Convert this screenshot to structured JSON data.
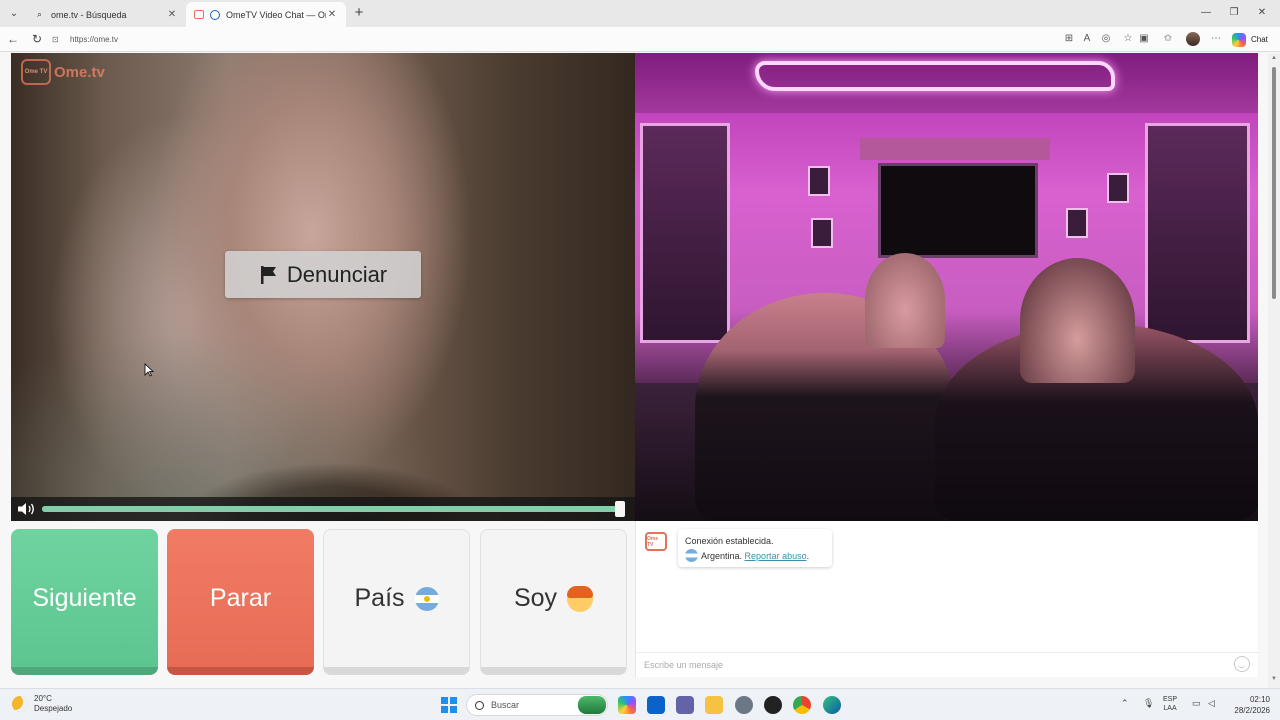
{
  "browser": {
    "tabs": [
      {
        "label": "ome.tv - Búsqueda",
        "close": "✕"
      },
      {
        "label": "OmeTV Video Chat — Omegle",
        "close": "✕"
      }
    ],
    "new_tab": "+",
    "url": "https://ome.tv",
    "chat_button": "Chat"
  },
  "video": {
    "logo_icon_text": "Ome TV",
    "logo_text": "Ome.tv",
    "report_label": "Denunciar",
    "volume_level": 1.0
  },
  "controls": {
    "next_label": "Siguiente",
    "stop_label": "Parar",
    "country_label": "País",
    "gender_label": "Soy"
  },
  "chat": {
    "status_line": "Conexión establecida.",
    "country": "Argentina.",
    "abuse_link": "Reportar abuso",
    "abuse_suffix": ".",
    "input_placeholder": "Escribe un mensaje"
  },
  "taskbar": {
    "temperature": "20°C",
    "weather": "Despejado",
    "search_placeholder": "Buscar",
    "lang_top": "ESP",
    "lang_bottom": "LAA",
    "time": "02:10",
    "date": "28/2/2026"
  },
  "colors": {
    "next_green": "#6fd3a0",
    "stop_red": "#f17b64",
    "accent_link": "#3a8fb0"
  }
}
